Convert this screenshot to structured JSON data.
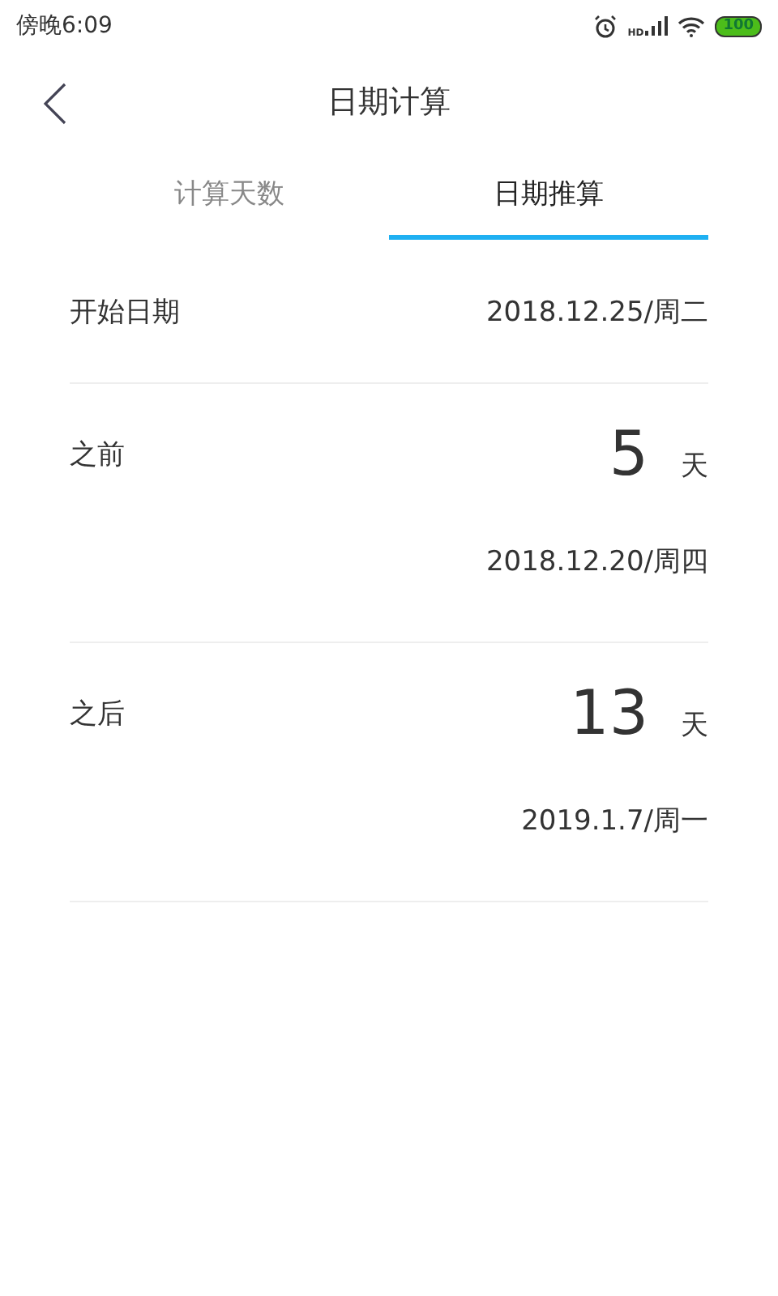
{
  "status_bar": {
    "time": "傍晚6:09",
    "network": "HD",
    "battery": "100"
  },
  "header": {
    "title": "日期计算"
  },
  "tabs": [
    {
      "label": "计算天数",
      "selected": false
    },
    {
      "label": "日期推算",
      "selected": true
    }
  ],
  "start": {
    "label": "开始日期",
    "value": "2018.12.25/周二"
  },
  "offsets": [
    {
      "label": "之前",
      "days": "5",
      "unit": "天",
      "result": "2018.12.20/周四"
    },
    {
      "label": "之后",
      "days": "13",
      "unit": "天",
      "result": "2019.1.7/周一"
    }
  ]
}
